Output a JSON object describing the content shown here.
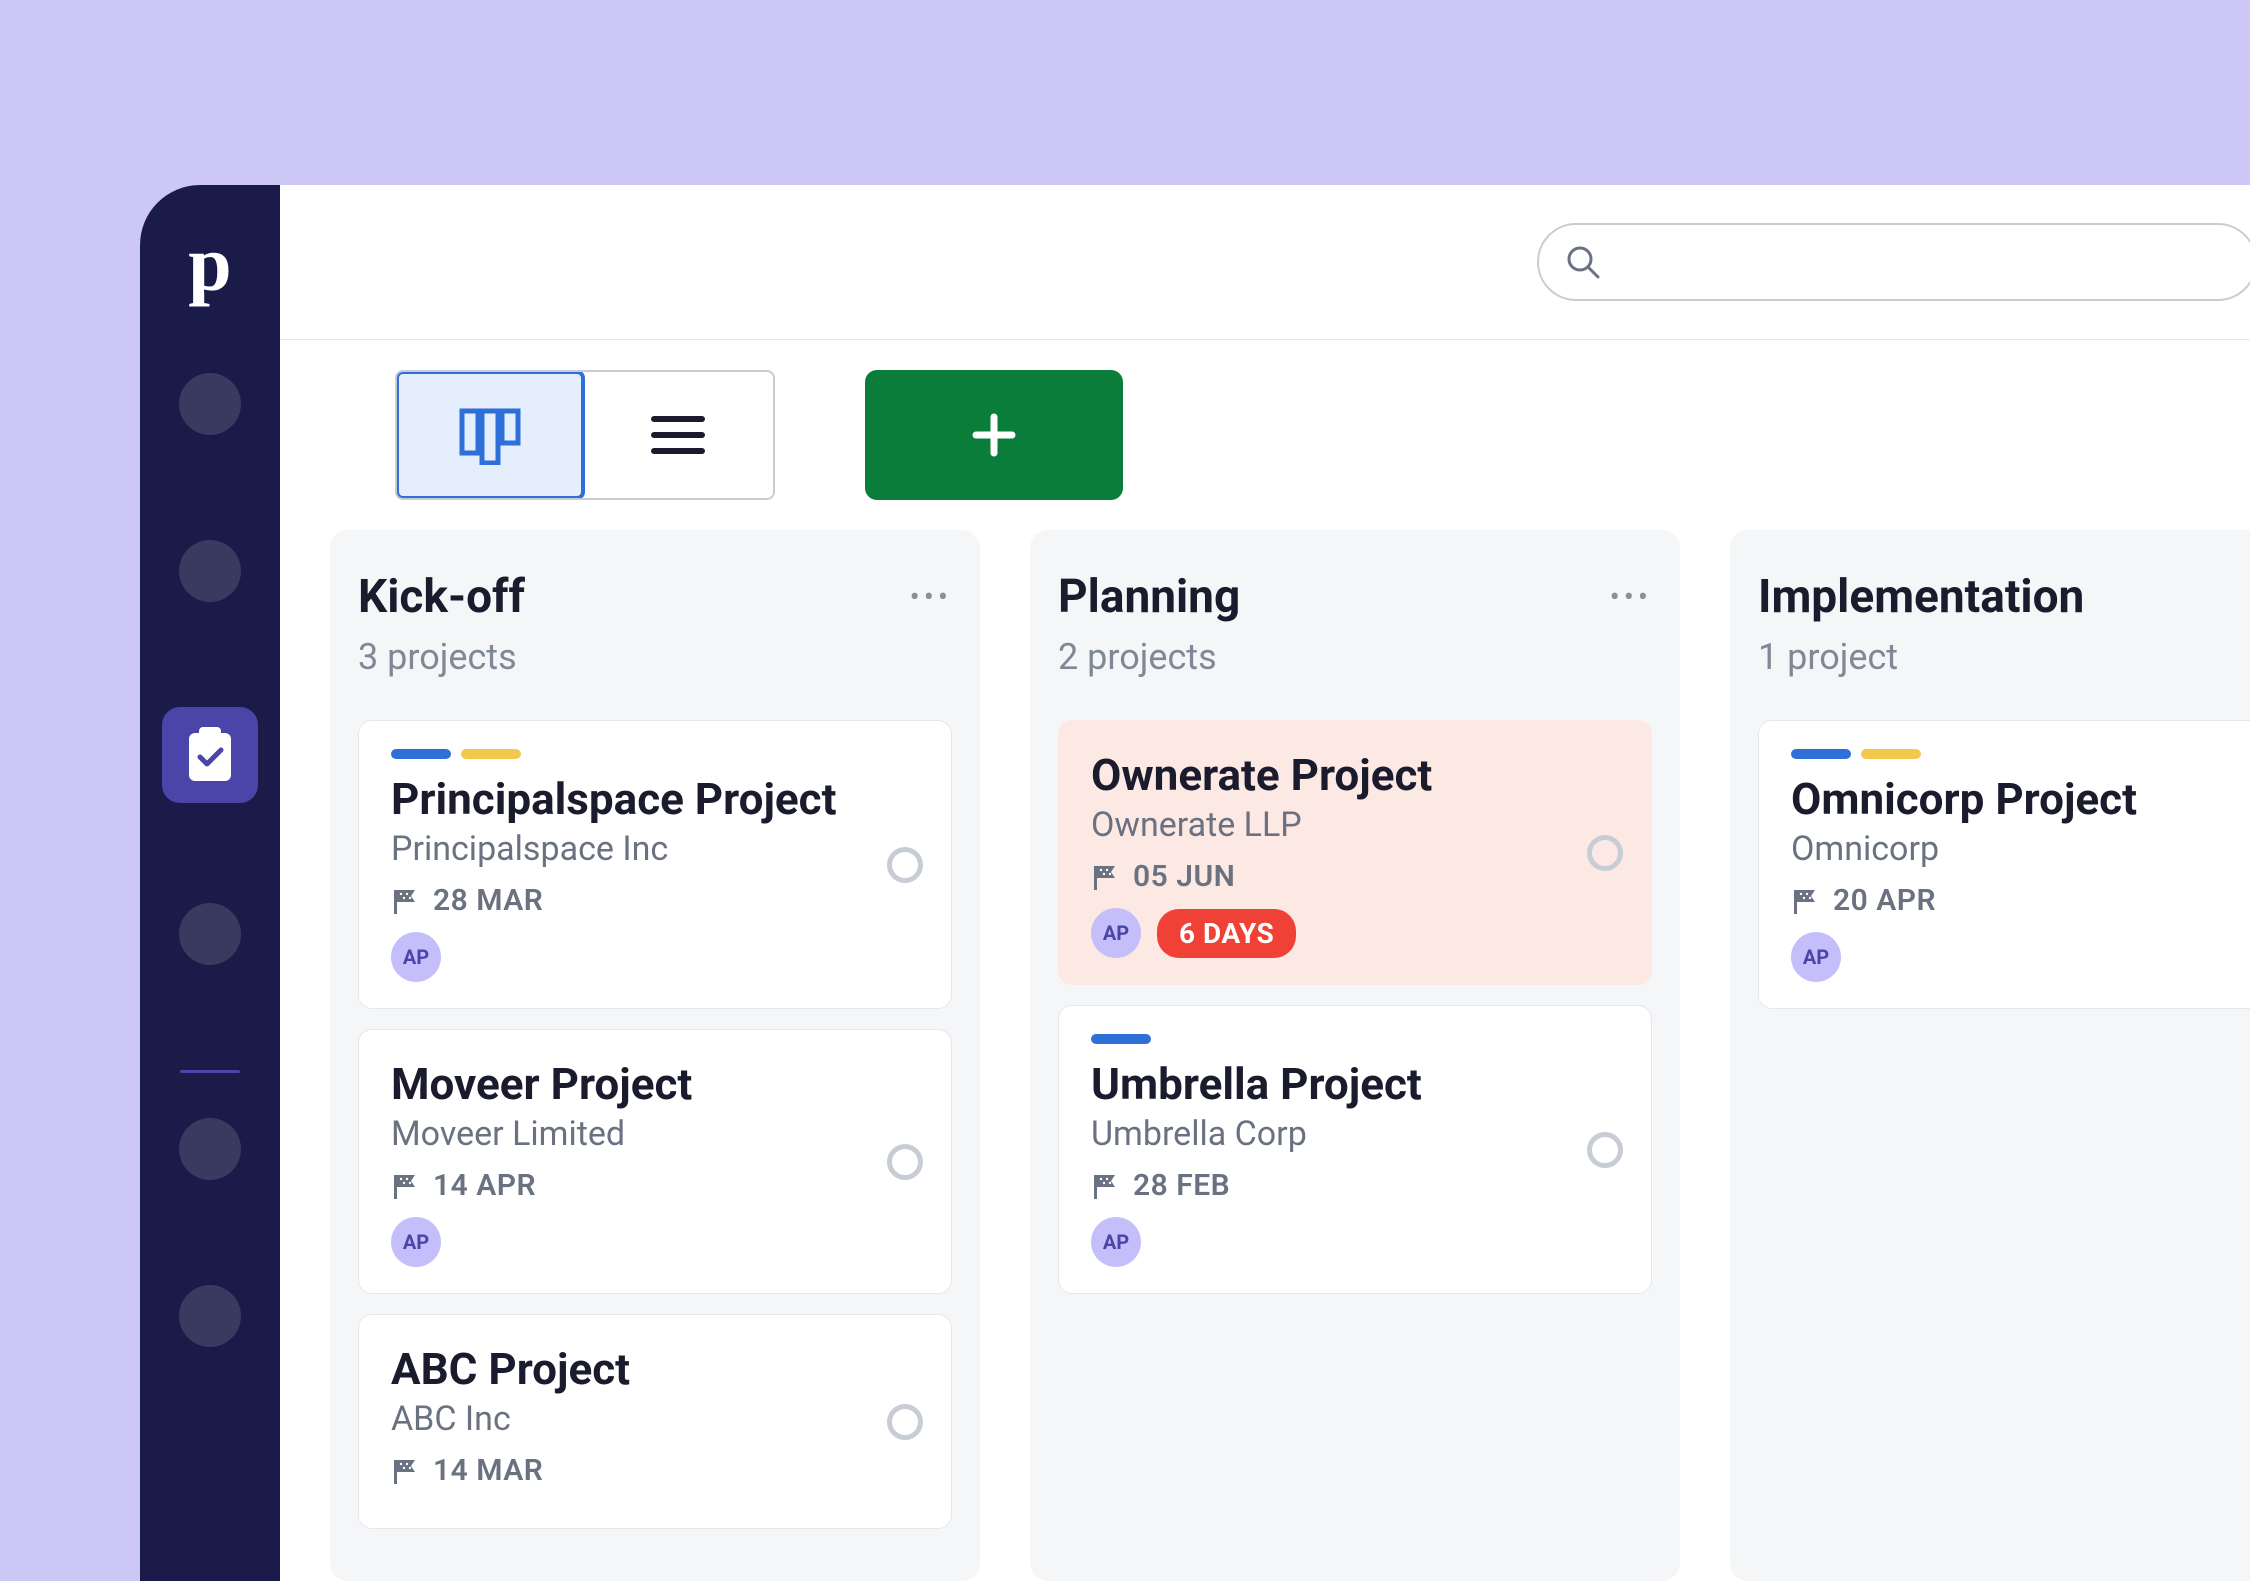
{
  "logo": "p",
  "search": {
    "placeholder": ""
  },
  "columns": [
    {
      "title": "Kick-off",
      "subtitle": "3 projects",
      "show_more": true,
      "cards": [
        {
          "pips": [
            "blue",
            "yellow"
          ],
          "title": "Principalspace Project",
          "org": "Principalspace Inc",
          "date": "28 MAR",
          "owner": "AP",
          "overdue": false,
          "badge": null
        },
        {
          "pips": [],
          "title": "Moveer Project",
          "org": "Moveer Limited",
          "date": "14 APR",
          "owner": "AP",
          "overdue": false,
          "badge": null
        },
        {
          "pips": [],
          "title": "ABC Project",
          "org": "ABC Inc",
          "date": "14 MAR",
          "owner": null,
          "overdue": false,
          "badge": null
        }
      ]
    },
    {
      "title": "Planning",
      "subtitle": "2 projects",
      "show_more": true,
      "cards": [
        {
          "pips": [],
          "title": "Ownerate Project",
          "org": "Ownerate LLP",
          "date": "05 JUN",
          "owner": "AP",
          "overdue": true,
          "badge": "6 DAYS"
        },
        {
          "pips": [
            "blue"
          ],
          "title": "Umbrella Project",
          "org": "Umbrella Corp",
          "date": "28 FEB",
          "owner": "AP",
          "overdue": false,
          "badge": null
        }
      ]
    },
    {
      "title": "Implementation",
      "subtitle": "1 project",
      "show_more": false,
      "cards": [
        {
          "pips": [
            "blue",
            "yellow"
          ],
          "title": "Omnicorp Project",
          "org": "Omnicorp",
          "date": "20 APR",
          "owner": "AP",
          "overdue": false,
          "badge": null
        }
      ]
    }
  ]
}
